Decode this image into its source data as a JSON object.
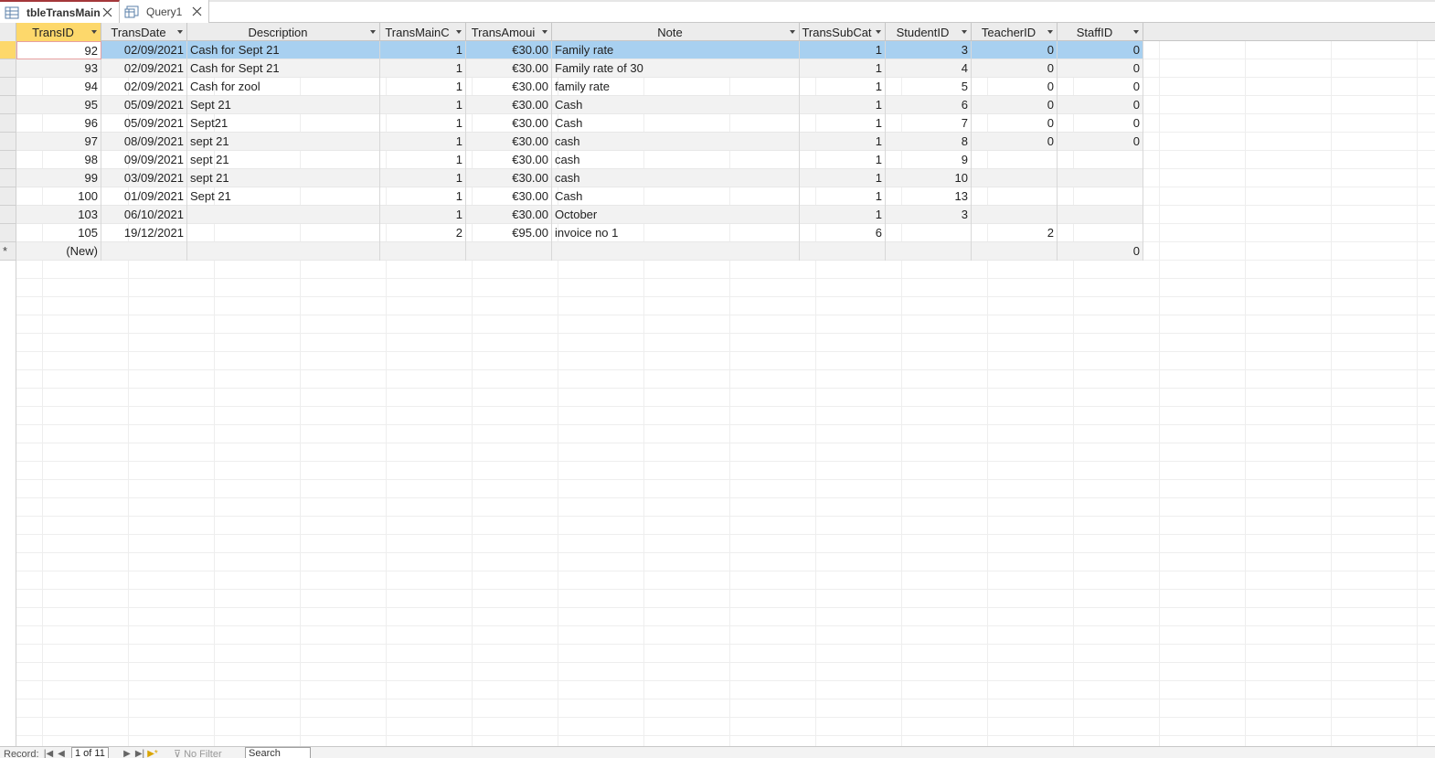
{
  "tabs": [
    {
      "label": "tbleTransMain",
      "icon": "table-icon",
      "active": true
    },
    {
      "label": "Query1",
      "icon": "query-icon",
      "active": false
    }
  ],
  "columns": [
    {
      "label": "TransID",
      "align": "right"
    },
    {
      "label": "TransDate",
      "align": "right"
    },
    {
      "label": "Description",
      "align": "left"
    },
    {
      "label": "TransMainC",
      "align": "right"
    },
    {
      "label": "TransAmoui",
      "align": "right"
    },
    {
      "label": "Note",
      "align": "left"
    },
    {
      "label": "TransSubCat",
      "align": "right"
    },
    {
      "label": "StudentID",
      "align": "right"
    },
    {
      "label": "TeacherID",
      "align": "right"
    },
    {
      "label": "StaffID",
      "align": "right"
    }
  ],
  "rows": [
    [
      "92",
      "02/09/2021",
      "Cash for Sept 21",
      "1",
      "€30.00",
      "Family rate",
      "1",
      "3",
      "0",
      "0"
    ],
    [
      "93",
      "02/09/2021",
      "Cash for Sept 21",
      "1",
      "€30.00",
      "Family rate of 30",
      "1",
      "4",
      "0",
      "0"
    ],
    [
      "94",
      "02/09/2021",
      "Cash for zool",
      "1",
      "€30.00",
      "family rate",
      "1",
      "5",
      "0",
      "0"
    ],
    [
      "95",
      "05/09/2021",
      "Sept 21",
      "1",
      "€30.00",
      "Cash",
      "1",
      "6",
      "0",
      "0"
    ],
    [
      "96",
      "05/09/2021",
      "Sept21",
      "1",
      "€30.00",
      "Cash",
      "1",
      "7",
      "0",
      "0"
    ],
    [
      "97",
      "08/09/2021",
      "sept 21",
      "1",
      "€30.00",
      "cash",
      "1",
      "8",
      "0",
      "0"
    ],
    [
      "98",
      "09/09/2021",
      "sept 21",
      "1",
      "€30.00",
      "cash",
      "1",
      "9",
      "",
      ""
    ],
    [
      "99",
      "03/09/2021",
      "sept 21",
      "1",
      "€30.00",
      "cash",
      "1",
      "10",
      "",
      ""
    ],
    [
      "100",
      "01/09/2021",
      "Sept 21",
      "1",
      "€30.00",
      "Cash",
      "1",
      "13",
      "",
      ""
    ],
    [
      "103",
      "06/10/2021",
      "",
      "1",
      "€30.00",
      "October",
      "1",
      "3",
      "",
      ""
    ],
    [
      "105",
      "19/12/2021",
      "",
      "2",
      "€95.00",
      "invoice no 1",
      "6",
      "",
      "2",
      ""
    ]
  ],
  "new_row": {
    "id_label": "(New)",
    "star": "*",
    "staff_default": "0"
  },
  "status": {
    "record_label": "Record:",
    "record_position": "1 of 11",
    "filter_label": "No Filter",
    "search_label": "Search"
  },
  "colors": {
    "accent": "#a4373a",
    "selected_row": "#a8d0f0",
    "current_marker": "#fdd86b"
  }
}
